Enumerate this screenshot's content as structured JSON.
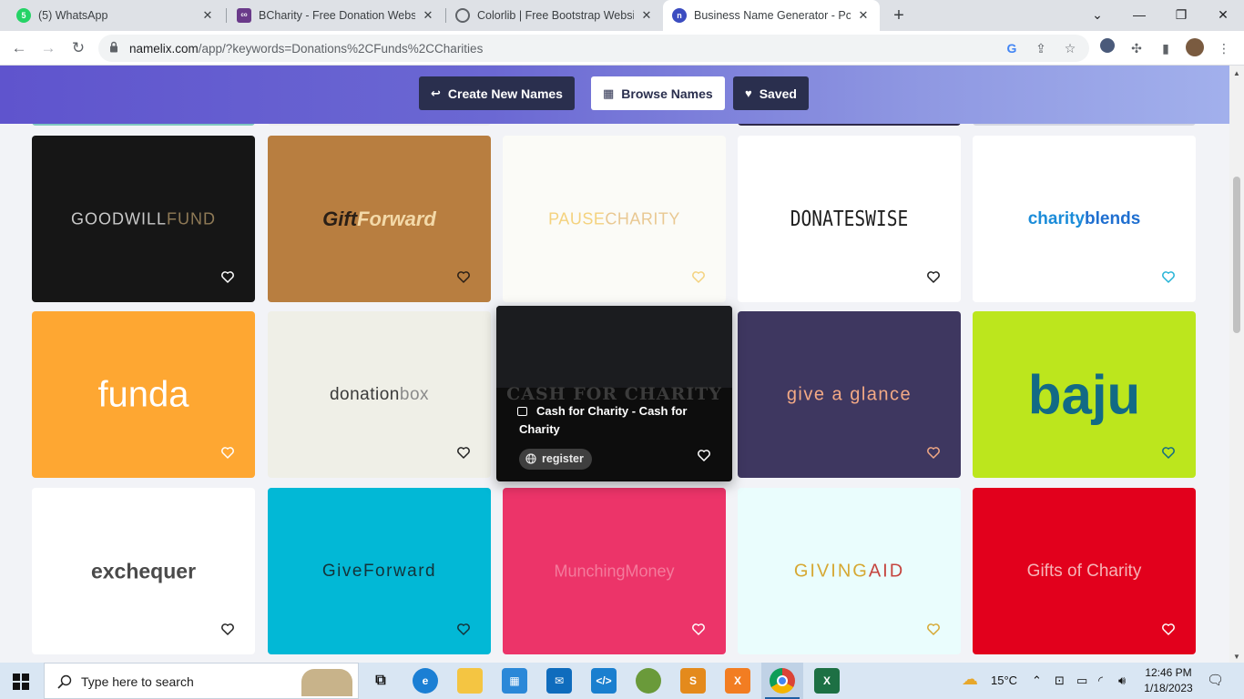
{
  "browser": {
    "tabs": [
      {
        "title": "(5) WhatsApp",
        "favicon_color": "#25d366",
        "favicon_text": "5"
      },
      {
        "title": "BCharity - Free Donation Website",
        "favicon_color": "#6a3a8a",
        "favicon_text": "co"
      },
      {
        "title": "Colorlib | Free Bootstrap Website",
        "favicon_color": "#5f6368",
        "favicon_text": ""
      },
      {
        "title": "Business Name Generator - Powe",
        "favicon_color": "#3b4cc0",
        "favicon_text": "n"
      }
    ],
    "active_tab_index": 3,
    "url_host": "namelix.com",
    "url_path": "/app/?keywords=Donations%2CFunds%2CCharities"
  },
  "header": {
    "create_label": "Create New Names",
    "browse_label": "Browse Names",
    "saved_label": "Saved"
  },
  "names": [
    {
      "text": "GOODWILL",
      "text2": "FUND",
      "bg": "#161616",
      "color": "#c9c9c9",
      "color2": "#8f7a56",
      "heart": "#ffffff"
    },
    {
      "text": "Gift",
      "text2": "Forward",
      "bg": "#b87e40",
      "color": "#2a1f16",
      "color2": "#f3d9a8",
      "heart": "#2a1f16"
    },
    {
      "text": "PAUSE",
      "text2": "CHARITY",
      "bg": "#fbfbf7",
      "color": "#f4d27e",
      "color2": "#e9c892",
      "heart": "#f4d27e"
    },
    {
      "text": "DONATES",
      "text2": "WISE",
      "bg": "#ffffff",
      "color": "#1e1e1e",
      "color2": "#1e1e1e",
      "heart": "#1e1e1e"
    },
    {
      "text": "charity",
      "text2": "blends",
      "bg": "#ffffff",
      "color": "#1b8cd9",
      "color2": "#1f6fd0",
      "heart": "#24b3d6"
    },
    {
      "text": "funda",
      "text2": "",
      "bg": "#fea732",
      "color": "#ffffff",
      "color2": "#ffffff",
      "heart": "#ffffff"
    },
    {
      "text": "donation",
      "text2": "box",
      "bg": "#efefe7",
      "color": "#3a3a3a",
      "color2": "#8a8a8a",
      "heart": "#222222"
    },
    {
      "text": "CASH FOR CHARITY",
      "text2": "",
      "bg": "#0d0d0d",
      "color": "#3b3b3b",
      "color2": "#3b3b3b",
      "heart": "#ffffff"
    },
    {
      "text": "give a glance",
      "text2": "",
      "bg": "#3e3760",
      "color": "#f3a985",
      "color2": "#f3a985",
      "heart": "#f3a985"
    },
    {
      "text": "baju",
      "text2": "",
      "bg": "#bce61d",
      "color": "#126a85",
      "color2": "#126a85",
      "heart": "#126a85"
    },
    {
      "text": "exchequer",
      "text2": "",
      "bg": "#ffffff",
      "color": "#4a4a4a",
      "color2": "#4a4a4a",
      "heart": "#222222"
    },
    {
      "text": "GiveForward",
      "text2": "",
      "bg": "#02b8d6",
      "color": "#14333a",
      "color2": "#14333a",
      "heart": "#14333a"
    },
    {
      "text": "MunchingMoney",
      "text2": "",
      "bg": "#ec3469",
      "color": "#f47b9c",
      "color2": "#f47b9c",
      "heart": "#ffffff"
    },
    {
      "text": "GIVING",
      "text2": "AID",
      "bg": "#eafdfd",
      "color": "#d6a833",
      "color2": "#c5453f",
      "heart": "#d6a833"
    },
    {
      "text": "Gifts of Charity",
      "text2": "",
      "bg": "#e2001c",
      "color": "#f6b3b7",
      "color2": "#f6b3b7",
      "heart": "#ffffff"
    }
  ],
  "hover_card": {
    "description": "Cash for Charity - Cash for Charity",
    "register_label": "register"
  },
  "taskbar": {
    "search_placeholder": "Type here to search",
    "temperature": "15°C",
    "time": "12:46 PM",
    "date": "1/18/2023"
  }
}
